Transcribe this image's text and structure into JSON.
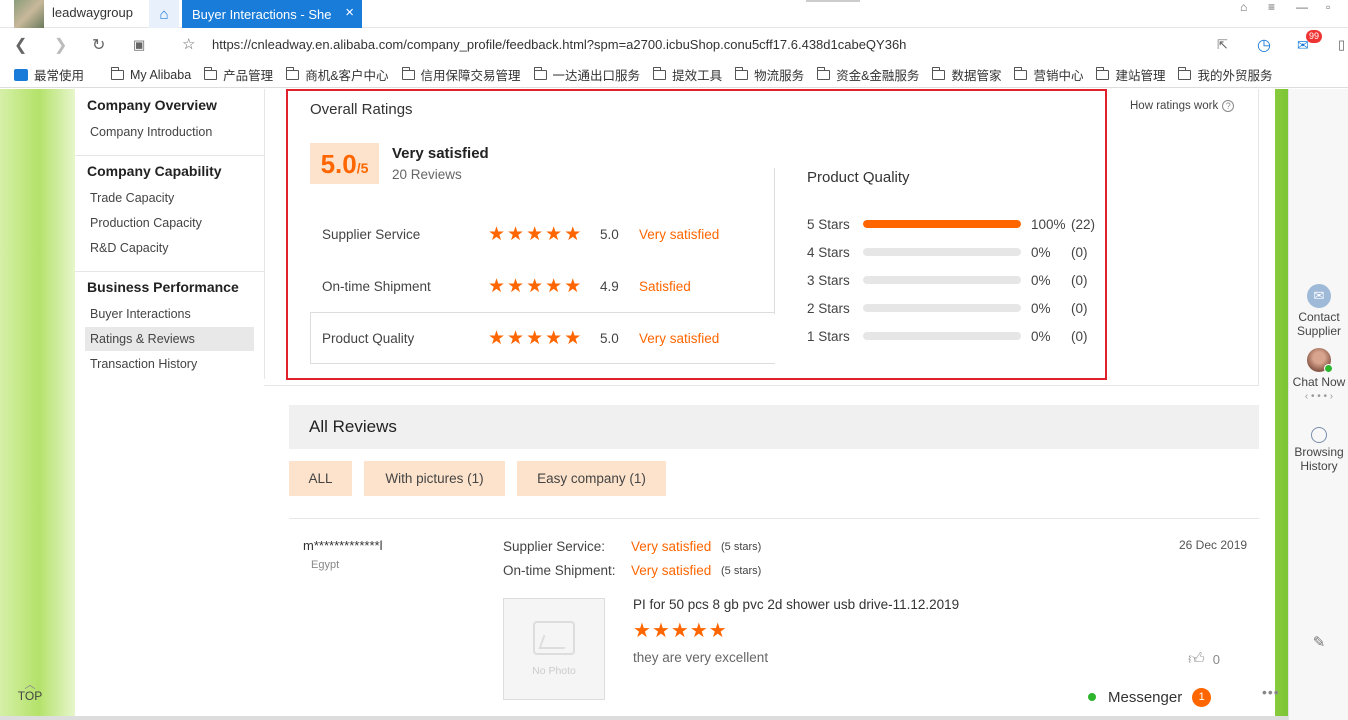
{
  "browser": {
    "profile_name": "leadwaygroup",
    "active_tab_title": "Buyer Interactions - She",
    "tab_close": "×",
    "url": "https://cnleadway.en.alibaba.com/company_profile/feedback.html?spm=a2700.icbuShop.conu5cff17.6.438d1cabeQY36h",
    "mail_badge": "99",
    "bookmarks": [
      "最常使用",
      "My Alibaba",
      "产品管理",
      "商机&客户中心",
      "信用保障交易管理",
      "一达通出口服务",
      "提效工具",
      "物流服务",
      "资金&金融服务",
      "数据管家",
      "营销中心",
      "建站管理",
      "我的外贸服务"
    ]
  },
  "sidebar": {
    "sections": [
      {
        "heading": "Company Overview",
        "items": [
          "Company Introduction"
        ]
      },
      {
        "heading": "Company Capability",
        "items": [
          "Trade Capacity",
          "Production Capacity",
          "R&D Capacity"
        ]
      },
      {
        "heading": "Business Performance",
        "items": [
          "Buyer Interactions",
          "Ratings & Reviews",
          "Transaction History"
        ]
      }
    ],
    "active_item": "Ratings & Reviews"
  },
  "overall": {
    "title": "Overall Ratings",
    "how_ratings": "How ratings work",
    "help_glyph": "?",
    "score": "5.0",
    "score_den": "/5",
    "score_text": "Very satisfied",
    "reviews_count": "20 Reviews",
    "rows": [
      {
        "label": "Supplier Service",
        "stars": 5,
        "score": "5.0",
        "word": "Very satisfied"
      },
      {
        "label": "On-time Shipment",
        "stars": 5,
        "score": "4.9",
        "word": "Satisfied"
      },
      {
        "label": "Product Quality",
        "stars": 5,
        "score": "5.0",
        "word": "Very satisfied"
      }
    ]
  },
  "product_quality": {
    "title": "Product Quality",
    "breakdown": [
      {
        "label": "5 Stars",
        "fraction": 1.0,
        "pct": "100%",
        "count": "(22)"
      },
      {
        "label": "4 Stars",
        "fraction": 0,
        "pct": "0%",
        "count": "(0)"
      },
      {
        "label": "3 Stars",
        "fraction": 0,
        "pct": "0%",
        "count": "(0)"
      },
      {
        "label": "2 Stars",
        "fraction": 0,
        "pct": "0%",
        "count": "(0)"
      },
      {
        "label": "1 Stars",
        "fraction": 0,
        "pct": "0%",
        "count": "(0)"
      }
    ]
  },
  "reviews": {
    "title": "All Reviews",
    "filters": [
      "ALL",
      "With pictures (1)",
      "Easy company (1)"
    ],
    "items": [
      {
        "reviewer": "m*************l",
        "country": "Egypt",
        "supplier_service_label": "Supplier Service:",
        "supplier_service_value": "Very satisfied",
        "supplier_service_stars": "(5 stars)",
        "shipment_label": "On-time Shipment:",
        "shipment_value": "Very satisfied",
        "shipment_stars": "(5 stars)",
        "date": "26 Dec 2019",
        "no_photo": "No Photo",
        "product": "PI for 50 pcs 8 gb pvc 2d shower usb drive-11.12.2019",
        "rating": 5,
        "comment": "they are very excellent",
        "likes": "0"
      }
    ]
  },
  "messenger": {
    "label": "Messenger",
    "badge": "1"
  },
  "rail": {
    "contact": "Contact Supplier",
    "chat": "Chat Now",
    "browsing": "Browsing History",
    "top": "TOP"
  }
}
